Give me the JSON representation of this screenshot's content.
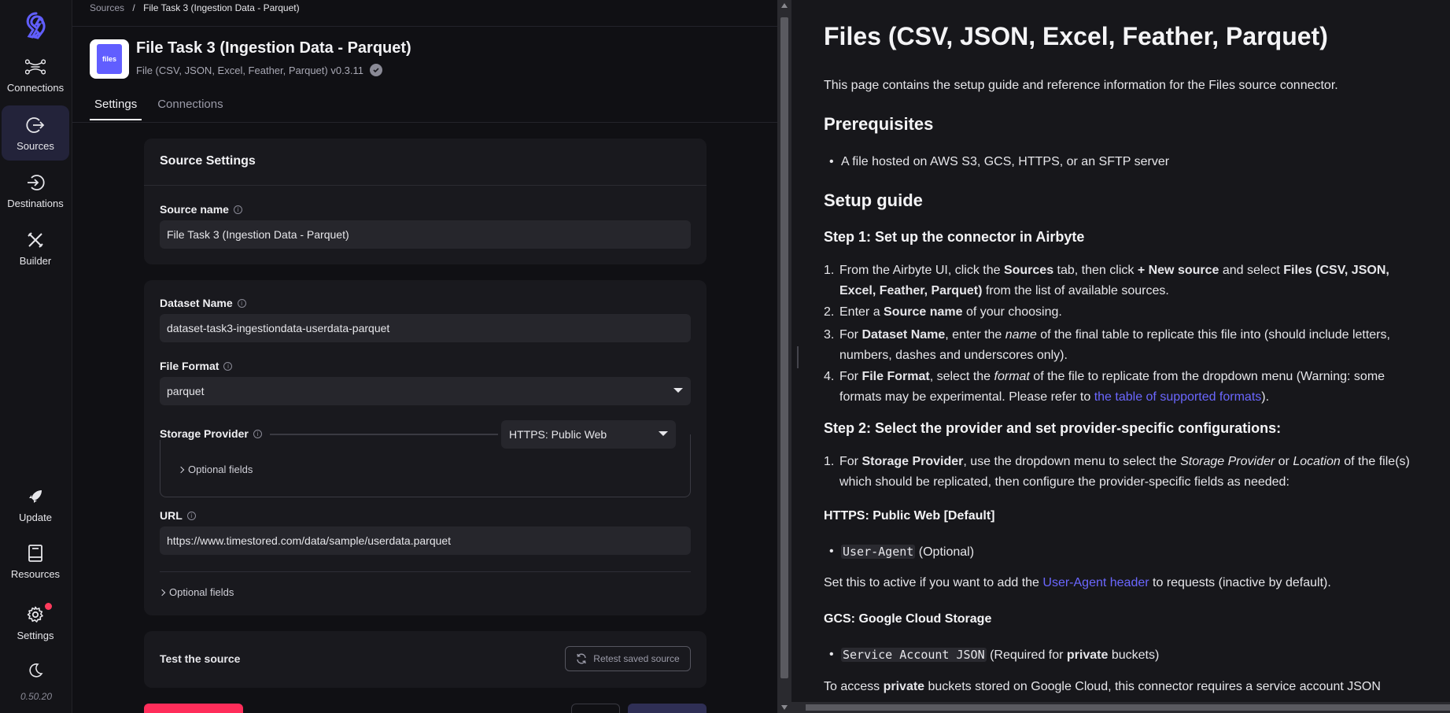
{
  "sidebar": {
    "items": [
      {
        "label": "Connections"
      },
      {
        "label": "Sources"
      },
      {
        "label": "Destinations"
      },
      {
        "label": "Builder"
      },
      {
        "label": "Update"
      },
      {
        "label": "Resources"
      },
      {
        "label": "Settings"
      }
    ],
    "version": "0.50.20"
  },
  "breadcrumb": {
    "root": "Sources",
    "sep": "/",
    "current": "File Task 3 (Ingestion Data - Parquet)"
  },
  "header": {
    "icon_text": "files",
    "title": "File Task 3 (Ingestion Data - Parquet)",
    "subtitle": "File (CSV, JSON, Excel, Feather, Parquet) v0.3.11"
  },
  "tabs": [
    {
      "label": "Settings"
    },
    {
      "label": "Connections"
    }
  ],
  "source_settings": {
    "title": "Source Settings",
    "source_name_label": "Source name",
    "source_name_value": "File Task 3 (Ingestion Data - Parquet)"
  },
  "form": {
    "dataset_label": "Dataset Name",
    "dataset_value": "dataset-task3-ingestiondata-userdata-parquet",
    "format_label": "File Format",
    "format_value": "parquet",
    "provider_label": "Storage Provider",
    "provider_value": "HTTPS: Public Web",
    "optional_fields_1": "Optional fields",
    "url_label": "URL",
    "url_value": "https://www.timestored.com/data/sample/userdata.parquet",
    "optional_fields_2": "Optional fields"
  },
  "test": {
    "title": "Test the source",
    "button": "Retest saved source"
  },
  "docs": {
    "title": "Files (CSV, JSON, Excel, Feather, Parquet)",
    "intro": "This page contains the setup guide and reference information for the Files source connector.",
    "prereq_title": "Prerequisites",
    "prereq_item": "A file hosted on AWS S3, GCS, HTTPS, or an SFTP server",
    "setup_title": "Setup guide",
    "step1_title": "Step 1: Set up the connector in Airbyte",
    "step2_title": "Step 2: Select the provider and set provider-specific configurations:",
    "https_title": "HTTPS: Public Web [Default]",
    "user_agent_code": "User-Agent",
    "user_agent_opt": "(Optional)",
    "user_agent_desc_pre": "Set this to active if you want to add the ",
    "user_agent_link": "User-Agent header",
    "user_agent_desc_post": " to requests (inactive by default).",
    "gcs_title": "GCS: Google Cloud Storage",
    "sa_code": "Service Account JSON",
    "sa_pre": "(Required for ",
    "sa_bold": "private",
    "sa_post": " buckets)",
    "gcs_desc_pre": "To access ",
    "gcs_desc_bold": "private",
    "gcs_desc_post": " buckets stored on Google Cloud, this connector requires a service account JSON"
  }
}
